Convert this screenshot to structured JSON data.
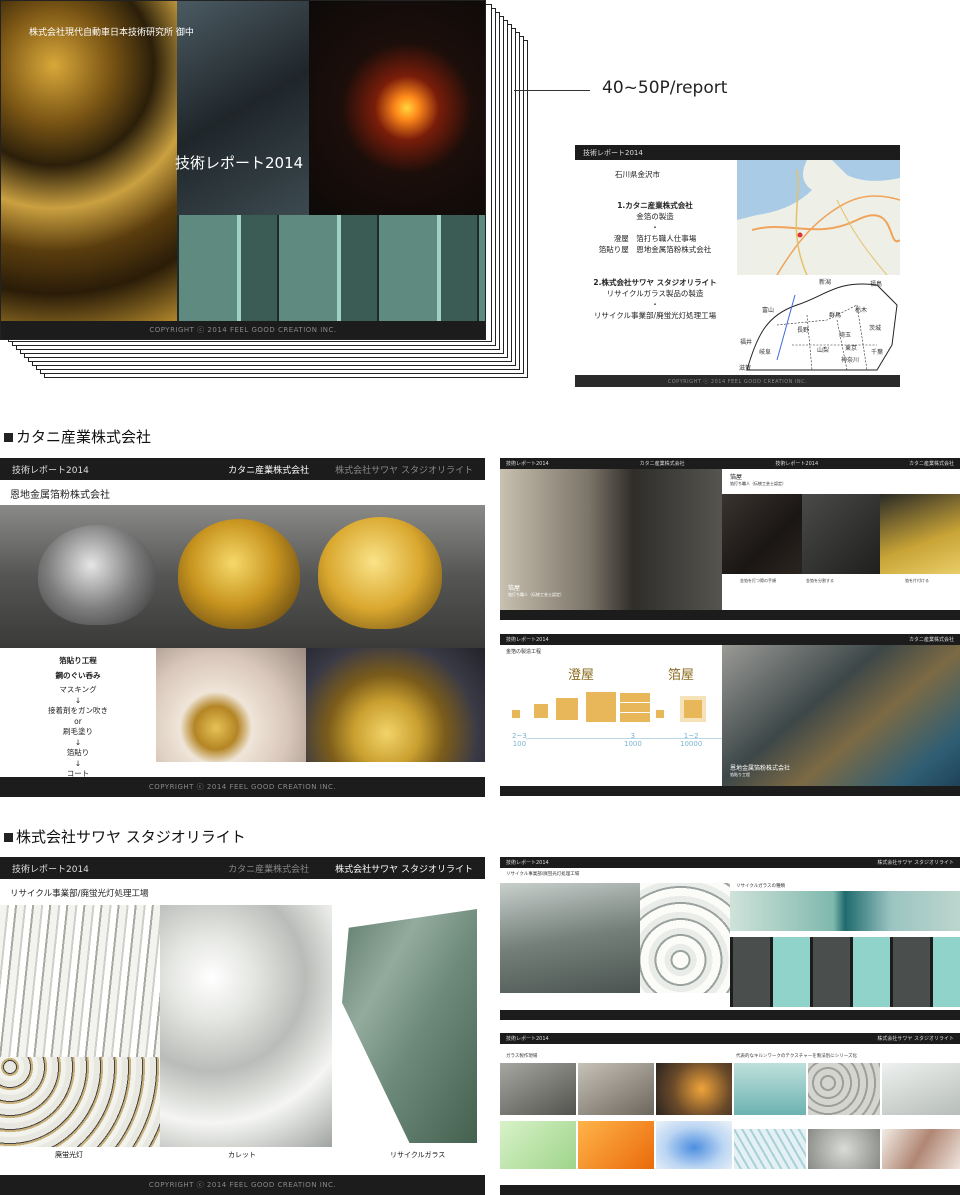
{
  "report_stack": {
    "client": "株式会社現代自動車日本技術研究所 御中",
    "title": "技術レポート2014",
    "copyright": "COPYRIGHT ⓒ 2014 FEEL GOOD CREATION INC.",
    "pages_label": "40~50P/report"
  },
  "map_slide": {
    "header": "技術レポート2014",
    "prefecture": "石川県金沢市",
    "company1": "1.カタニ産業株式会社",
    "company1_sub": "金箔の製造",
    "dot1": "・",
    "company1_detail1": "澄屋　箔打ち職人仕事場",
    "company1_detail2": "箔貼り屋　恩地金属箔粉株式会社",
    "company2": "2.株式会社サワヤ スタジオリライト",
    "company2_sub": "リサイクルガラス製品の製造",
    "dot2": "・",
    "company2_detail": "リサイクル事業部/廃蛍光灯処理工場",
    "map_labels": [
      "新潟",
      "福島",
      "富山",
      "群馬",
      "栃木",
      "茨城",
      "長野",
      "埼玉",
      "福井",
      "岐阜",
      "山梨",
      "東京",
      "千葉",
      "神奈川",
      "滋賀"
    ],
    "copyright": "COPYRIGHT ⓒ 2014 FEEL GOOD CREATION INC."
  },
  "section1": {
    "title": "カタニ産業株式会社",
    "slide": {
      "header_left": "技術レポート2014",
      "header_active": "カタニ産業株式会社",
      "header_inactive": "株式会社サワヤ スタジオリライト",
      "subtitle": "恩地金属箔粉株式会社",
      "process_title": "箔貼り工程",
      "process_item": "鋼のぐい呑み",
      "steps": [
        "マスキング",
        "↓",
        "接着剤をガン吹き",
        "or",
        "刷毛塗り",
        "↓",
        "箔貼り",
        "↓",
        "コート"
      ],
      "copyright": "COPYRIGHT ⓒ 2014 FEEL GOOD CREATION INC."
    },
    "thumb_a": {
      "header_left": "技術レポート2014",
      "header_mid": "カタニ産業株式会社",
      "header_left2": "技術レポート2014",
      "header_mid2": "カタニ産業株式会社",
      "left_caption": "箔屋",
      "left_caption_sub": "箔打ち職人（伝統工芸士認定）",
      "right_title": "箔屋",
      "right_sub": "箔打ち職人（伝統工芸士認定）",
      "notes": [
        "金箔を打つ際の手順",
        "金箔を分割する",
        "箔を片付ける"
      ]
    },
    "thumb_b": {
      "header_left": "技術レポート2014",
      "header_mid": "カタニ産業株式会社",
      "diagram_title": "金箔の製造工程",
      "stage1": "澄屋",
      "stage2": "箔屋",
      "ratio1": "2~3",
      "ratio1b": "100",
      "ratio2": "3",
      "ratio2b": "1000",
      "ratio3": "1~2",
      "ratio3b": "10000",
      "photo_caption": "恩地金属箔粉株式会社",
      "photo_caption_sub": "箔貼り工程"
    }
  },
  "section2": {
    "title": "株式会社サワヤ スタジオリライト",
    "slide": {
      "header_left": "技術レポート2014",
      "header_inactive": "カタニ産業株式会社",
      "header_active": "株式会社サワヤ スタジオリライト",
      "subtitle": "リサイクル事業部/廃蛍光灯処理工場",
      "caption1": "廃蛍光灯",
      "caption2": "カレット",
      "caption3": "リサイクルガラス",
      "copyright": "COPYRIGHT ⓒ 2014 FEEL GOOD CREATION INC."
    },
    "thumb_c": {
      "header_left": "技術レポート2014",
      "header_mid": "株式会社サワヤ スタジオリライト",
      "left_sub": "リサイクル事業部/廃蛍光灯処理工場",
      "right_sub": "リサイクルガラスの種類"
    },
    "thumb_d": {
      "header_left": "技術レポート2014",
      "header_mid": "株式会社サワヤ スタジオリライト",
      "left_sub": "ガラス製作現場",
      "right_sub": "代表的なキルンワークのテクスチャーを製法別にシリーズ化"
    }
  }
}
